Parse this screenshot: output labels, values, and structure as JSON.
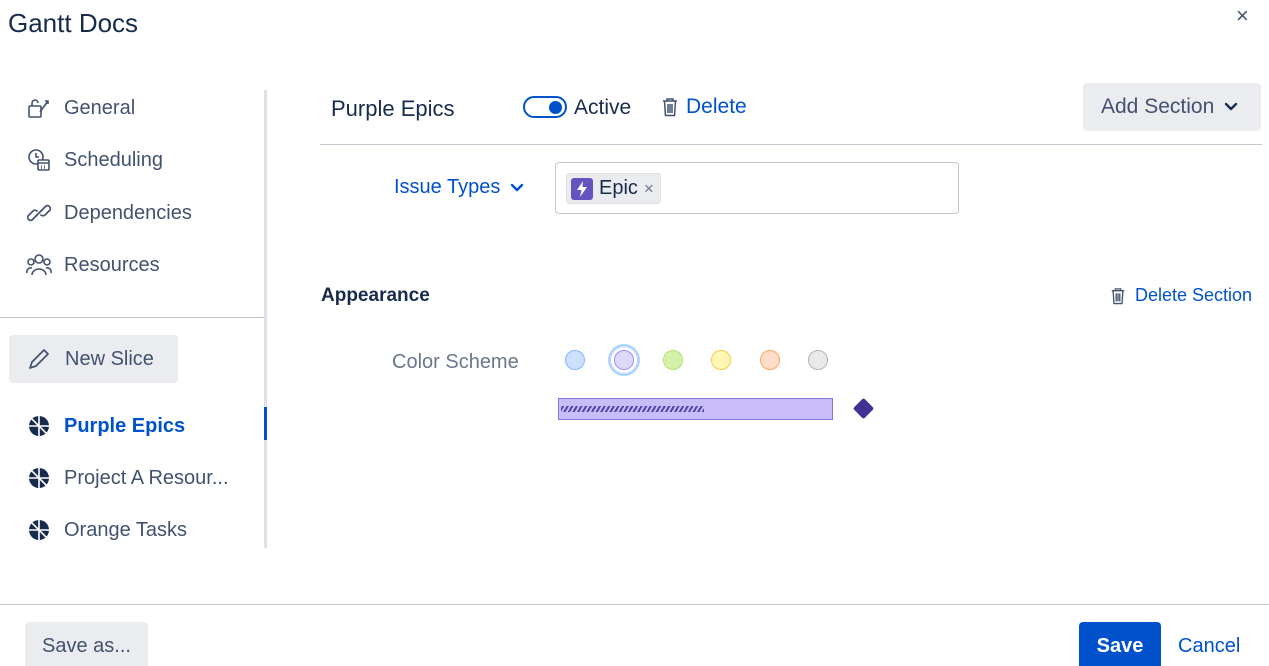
{
  "window": {
    "title": "Gantt Docs",
    "close_icon": "×"
  },
  "sidebar": {
    "items": [
      {
        "label": "General",
        "icon": "key-icon"
      },
      {
        "label": "Scheduling",
        "icon": "calendar-clock-icon"
      },
      {
        "label": "Dependencies",
        "icon": "link-icon"
      },
      {
        "label": "Resources",
        "icon": "people-icon"
      }
    ],
    "new_slice_label": "New Slice",
    "slices": [
      {
        "label": "Purple Epics",
        "active": true
      },
      {
        "label": "Project A Resour...",
        "active": false
      },
      {
        "label": "Orange Tasks",
        "active": false
      }
    ]
  },
  "header": {
    "slice_name": "Purple Epics",
    "active_label": "Active",
    "active_on": true,
    "delete_label": "Delete",
    "add_section_label": "Add Section"
  },
  "issue_types": {
    "label": "Issue Types",
    "tags": [
      {
        "label": "Epic",
        "remove": "×"
      }
    ]
  },
  "appearance": {
    "heading": "Appearance",
    "delete_section_label": "Delete Section",
    "color_scheme_label": "Color Scheme",
    "swatches": [
      {
        "name": "blue",
        "fill": "#cce0ff",
        "border": "#85b8ff",
        "selected": false
      },
      {
        "name": "purple",
        "fill": "#dfd8fd",
        "border": "#9f8fef",
        "selected": true
      },
      {
        "name": "green",
        "fill": "#d3f1a7",
        "border": "#b3df72",
        "selected": false
      },
      {
        "name": "yellow",
        "fill": "#fff7b5",
        "border": "#f5cd47",
        "selected": false
      },
      {
        "name": "orange",
        "fill": "#fedec8",
        "border": "#fea362",
        "selected": false
      },
      {
        "name": "gray",
        "fill": "#e9e9e9",
        "border": "#b3b3b3",
        "selected": false
      }
    ],
    "preview_progress": 0.53
  },
  "footer": {
    "save_as_label": "Save as...",
    "save_label": "Save",
    "cancel_label": "Cancel"
  },
  "colors": {
    "accent": "#0052cc",
    "epic": "#6554c0",
    "text": "#172b4d"
  }
}
